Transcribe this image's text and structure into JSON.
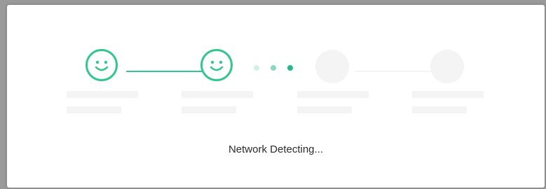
{
  "colors": {
    "accent": "#35c58e",
    "dots": [
      "#d2f0e4",
      "#8ad9bb",
      "#1fbd85"
    ]
  },
  "steps": [
    {
      "state": "complete",
      "icon": "smiley-icon"
    },
    {
      "state": "complete",
      "icon": "smiley-icon"
    },
    {
      "state": "pending",
      "icon": ""
    },
    {
      "state": "pending",
      "icon": ""
    }
  ],
  "status": {
    "text": "Network Detecting..."
  }
}
